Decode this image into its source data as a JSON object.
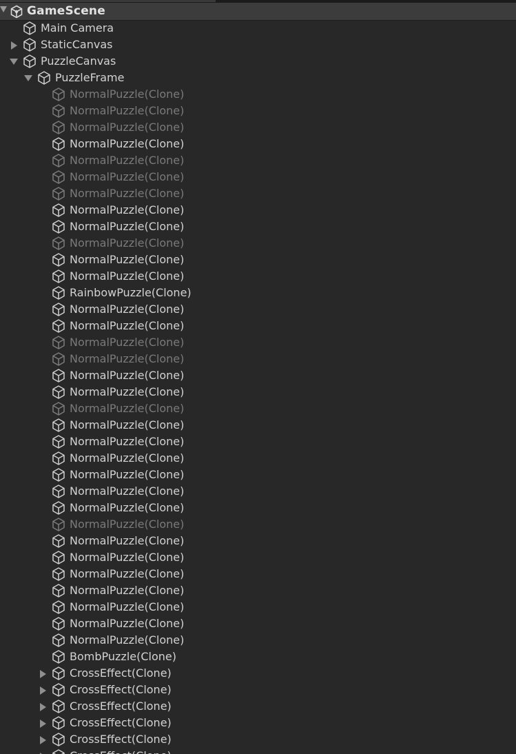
{
  "scene": {
    "title": "GameScene",
    "icon": "unity-icon"
  },
  "rows": [
    {
      "label": "Main Camera",
      "level": 0,
      "fold": "none",
      "active": true,
      "icon": "gameobject-icon"
    },
    {
      "label": "StaticCanvas",
      "level": 0,
      "fold": "collapsed",
      "active": true,
      "icon": "gameobject-icon"
    },
    {
      "label": "PuzzleCanvas",
      "level": 0,
      "fold": "expanded",
      "active": true,
      "icon": "gameobject-icon"
    },
    {
      "label": "PuzzleFrame",
      "level": 1,
      "fold": "expanded",
      "active": true,
      "icon": "gameobject-icon"
    },
    {
      "label": "NormalPuzzle(Clone)",
      "level": 2,
      "fold": "none",
      "active": false,
      "icon": "gameobject-icon"
    },
    {
      "label": "NormalPuzzle(Clone)",
      "level": 2,
      "fold": "none",
      "active": false,
      "icon": "gameobject-icon"
    },
    {
      "label": "NormalPuzzle(Clone)",
      "level": 2,
      "fold": "none",
      "active": false,
      "icon": "gameobject-icon"
    },
    {
      "label": "NormalPuzzle(Clone)",
      "level": 2,
      "fold": "none",
      "active": true,
      "icon": "gameobject-icon"
    },
    {
      "label": "NormalPuzzle(Clone)",
      "level": 2,
      "fold": "none",
      "active": false,
      "icon": "gameobject-icon"
    },
    {
      "label": "NormalPuzzle(Clone)",
      "level": 2,
      "fold": "none",
      "active": false,
      "icon": "gameobject-icon"
    },
    {
      "label": "NormalPuzzle(Clone)",
      "level": 2,
      "fold": "none",
      "active": false,
      "icon": "gameobject-icon"
    },
    {
      "label": "NormalPuzzle(Clone)",
      "level": 2,
      "fold": "none",
      "active": true,
      "icon": "gameobject-icon"
    },
    {
      "label": "NormalPuzzle(Clone)",
      "level": 2,
      "fold": "none",
      "active": true,
      "icon": "gameobject-icon"
    },
    {
      "label": "NormalPuzzle(Clone)",
      "level": 2,
      "fold": "none",
      "active": false,
      "icon": "gameobject-icon"
    },
    {
      "label": "NormalPuzzle(Clone)",
      "level": 2,
      "fold": "none",
      "active": true,
      "icon": "gameobject-icon"
    },
    {
      "label": "NormalPuzzle(Clone)",
      "level": 2,
      "fold": "none",
      "active": true,
      "icon": "gameobject-icon"
    },
    {
      "label": "RainbowPuzzle(Clone)",
      "level": 2,
      "fold": "none",
      "active": true,
      "icon": "gameobject-icon"
    },
    {
      "label": "NormalPuzzle(Clone)",
      "level": 2,
      "fold": "none",
      "active": true,
      "icon": "gameobject-icon"
    },
    {
      "label": "NormalPuzzle(Clone)",
      "level": 2,
      "fold": "none",
      "active": true,
      "icon": "gameobject-icon"
    },
    {
      "label": "NormalPuzzle(Clone)",
      "level": 2,
      "fold": "none",
      "active": false,
      "icon": "gameobject-icon"
    },
    {
      "label": "NormalPuzzle(Clone)",
      "level": 2,
      "fold": "none",
      "active": false,
      "icon": "gameobject-icon"
    },
    {
      "label": "NormalPuzzle(Clone)",
      "level": 2,
      "fold": "none",
      "active": true,
      "icon": "gameobject-icon"
    },
    {
      "label": "NormalPuzzle(Clone)",
      "level": 2,
      "fold": "none",
      "active": true,
      "icon": "gameobject-icon"
    },
    {
      "label": "NormalPuzzle(Clone)",
      "level": 2,
      "fold": "none",
      "active": false,
      "icon": "gameobject-icon"
    },
    {
      "label": "NormalPuzzle(Clone)",
      "level": 2,
      "fold": "none",
      "active": true,
      "icon": "gameobject-icon"
    },
    {
      "label": "NormalPuzzle(Clone)",
      "level": 2,
      "fold": "none",
      "active": true,
      "icon": "gameobject-icon"
    },
    {
      "label": "NormalPuzzle(Clone)",
      "level": 2,
      "fold": "none",
      "active": true,
      "icon": "gameobject-icon"
    },
    {
      "label": "NormalPuzzle(Clone)",
      "level": 2,
      "fold": "none",
      "active": true,
      "icon": "gameobject-icon"
    },
    {
      "label": "NormalPuzzle(Clone)",
      "level": 2,
      "fold": "none",
      "active": true,
      "icon": "gameobject-icon"
    },
    {
      "label": "NormalPuzzle(Clone)",
      "level": 2,
      "fold": "none",
      "active": true,
      "icon": "gameobject-icon"
    },
    {
      "label": "NormalPuzzle(Clone)",
      "level": 2,
      "fold": "none",
      "active": false,
      "icon": "gameobject-icon"
    },
    {
      "label": "NormalPuzzle(Clone)",
      "level": 2,
      "fold": "none",
      "active": true,
      "icon": "gameobject-icon"
    },
    {
      "label": "NormalPuzzle(Clone)",
      "level": 2,
      "fold": "none",
      "active": true,
      "icon": "gameobject-icon"
    },
    {
      "label": "NormalPuzzle(Clone)",
      "level": 2,
      "fold": "none",
      "active": true,
      "icon": "gameobject-icon"
    },
    {
      "label": "NormalPuzzle(Clone)",
      "level": 2,
      "fold": "none",
      "active": true,
      "icon": "gameobject-icon"
    },
    {
      "label": "NormalPuzzle(Clone)",
      "level": 2,
      "fold": "none",
      "active": true,
      "icon": "gameobject-icon"
    },
    {
      "label": "NormalPuzzle(Clone)",
      "level": 2,
      "fold": "none",
      "active": true,
      "icon": "gameobject-icon"
    },
    {
      "label": "NormalPuzzle(Clone)",
      "level": 2,
      "fold": "none",
      "active": true,
      "icon": "gameobject-icon"
    },
    {
      "label": "BombPuzzle(Clone)",
      "level": 2,
      "fold": "none",
      "active": true,
      "icon": "gameobject-icon"
    },
    {
      "label": "CrossEffect(Clone)",
      "level": 2,
      "fold": "collapsed",
      "active": true,
      "icon": "gameobject-icon"
    },
    {
      "label": "CrossEffect(Clone)",
      "level": 2,
      "fold": "collapsed",
      "active": true,
      "icon": "gameobject-icon"
    },
    {
      "label": "CrossEffect(Clone)",
      "level": 2,
      "fold": "collapsed",
      "active": true,
      "icon": "gameobject-icon"
    },
    {
      "label": "CrossEffect(Clone)",
      "level": 2,
      "fold": "collapsed",
      "active": true,
      "icon": "gameobject-icon"
    },
    {
      "label": "CrossEffect(Clone)",
      "level": 2,
      "fold": "collapsed",
      "active": true,
      "icon": "gameobject-icon"
    },
    {
      "label": "CrossEffect(Clone)",
      "level": 2,
      "fold": "collapsed",
      "active": true,
      "icon": "gameobject-icon"
    }
  ]
}
